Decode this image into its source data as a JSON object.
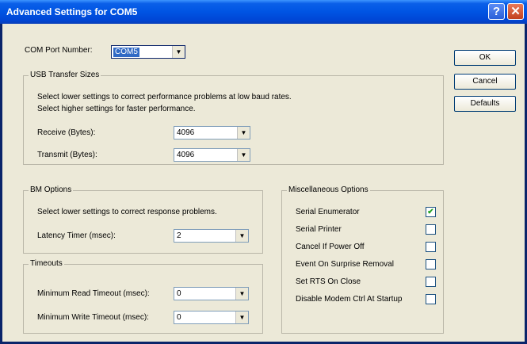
{
  "window": {
    "title": "Advanced Settings for COM5"
  },
  "com_port": {
    "label": "COM Port Number:",
    "value": "COM5"
  },
  "usb": {
    "legend": "USB Transfer Sizes",
    "desc1": "Select lower settings to correct performance problems at low baud rates.",
    "desc2": "Select higher settings for faster performance.",
    "receive_label": "Receive (Bytes):",
    "receive_value": "4096",
    "transmit_label": "Transmit (Bytes):",
    "transmit_value": "4096"
  },
  "bm": {
    "legend": "BM Options",
    "desc": "Select lower settings to correct response problems.",
    "latency_label": "Latency Timer (msec):",
    "latency_value": "2"
  },
  "timeouts": {
    "legend": "Timeouts",
    "read_label": "Minimum Read Timeout (msec):",
    "read_value": "0",
    "write_label": "Minimum Write Timeout (msec):",
    "write_value": "0"
  },
  "misc": {
    "legend": "Miscellaneous Options",
    "options": [
      {
        "label": "Serial Enumerator",
        "checked": true
      },
      {
        "label": "Serial Printer",
        "checked": false
      },
      {
        "label": "Cancel If Power Off",
        "checked": false
      },
      {
        "label": "Event On Surprise Removal",
        "checked": false
      },
      {
        "label": "Set RTS On Close",
        "checked": false
      },
      {
        "label": "Disable Modem Ctrl At Startup",
        "checked": false
      }
    ]
  },
  "buttons": {
    "ok": "OK",
    "cancel": "Cancel",
    "defaults": "Defaults"
  },
  "icons": {
    "help": "?",
    "close": "✕",
    "dropdown": "▼",
    "check": "✔"
  }
}
